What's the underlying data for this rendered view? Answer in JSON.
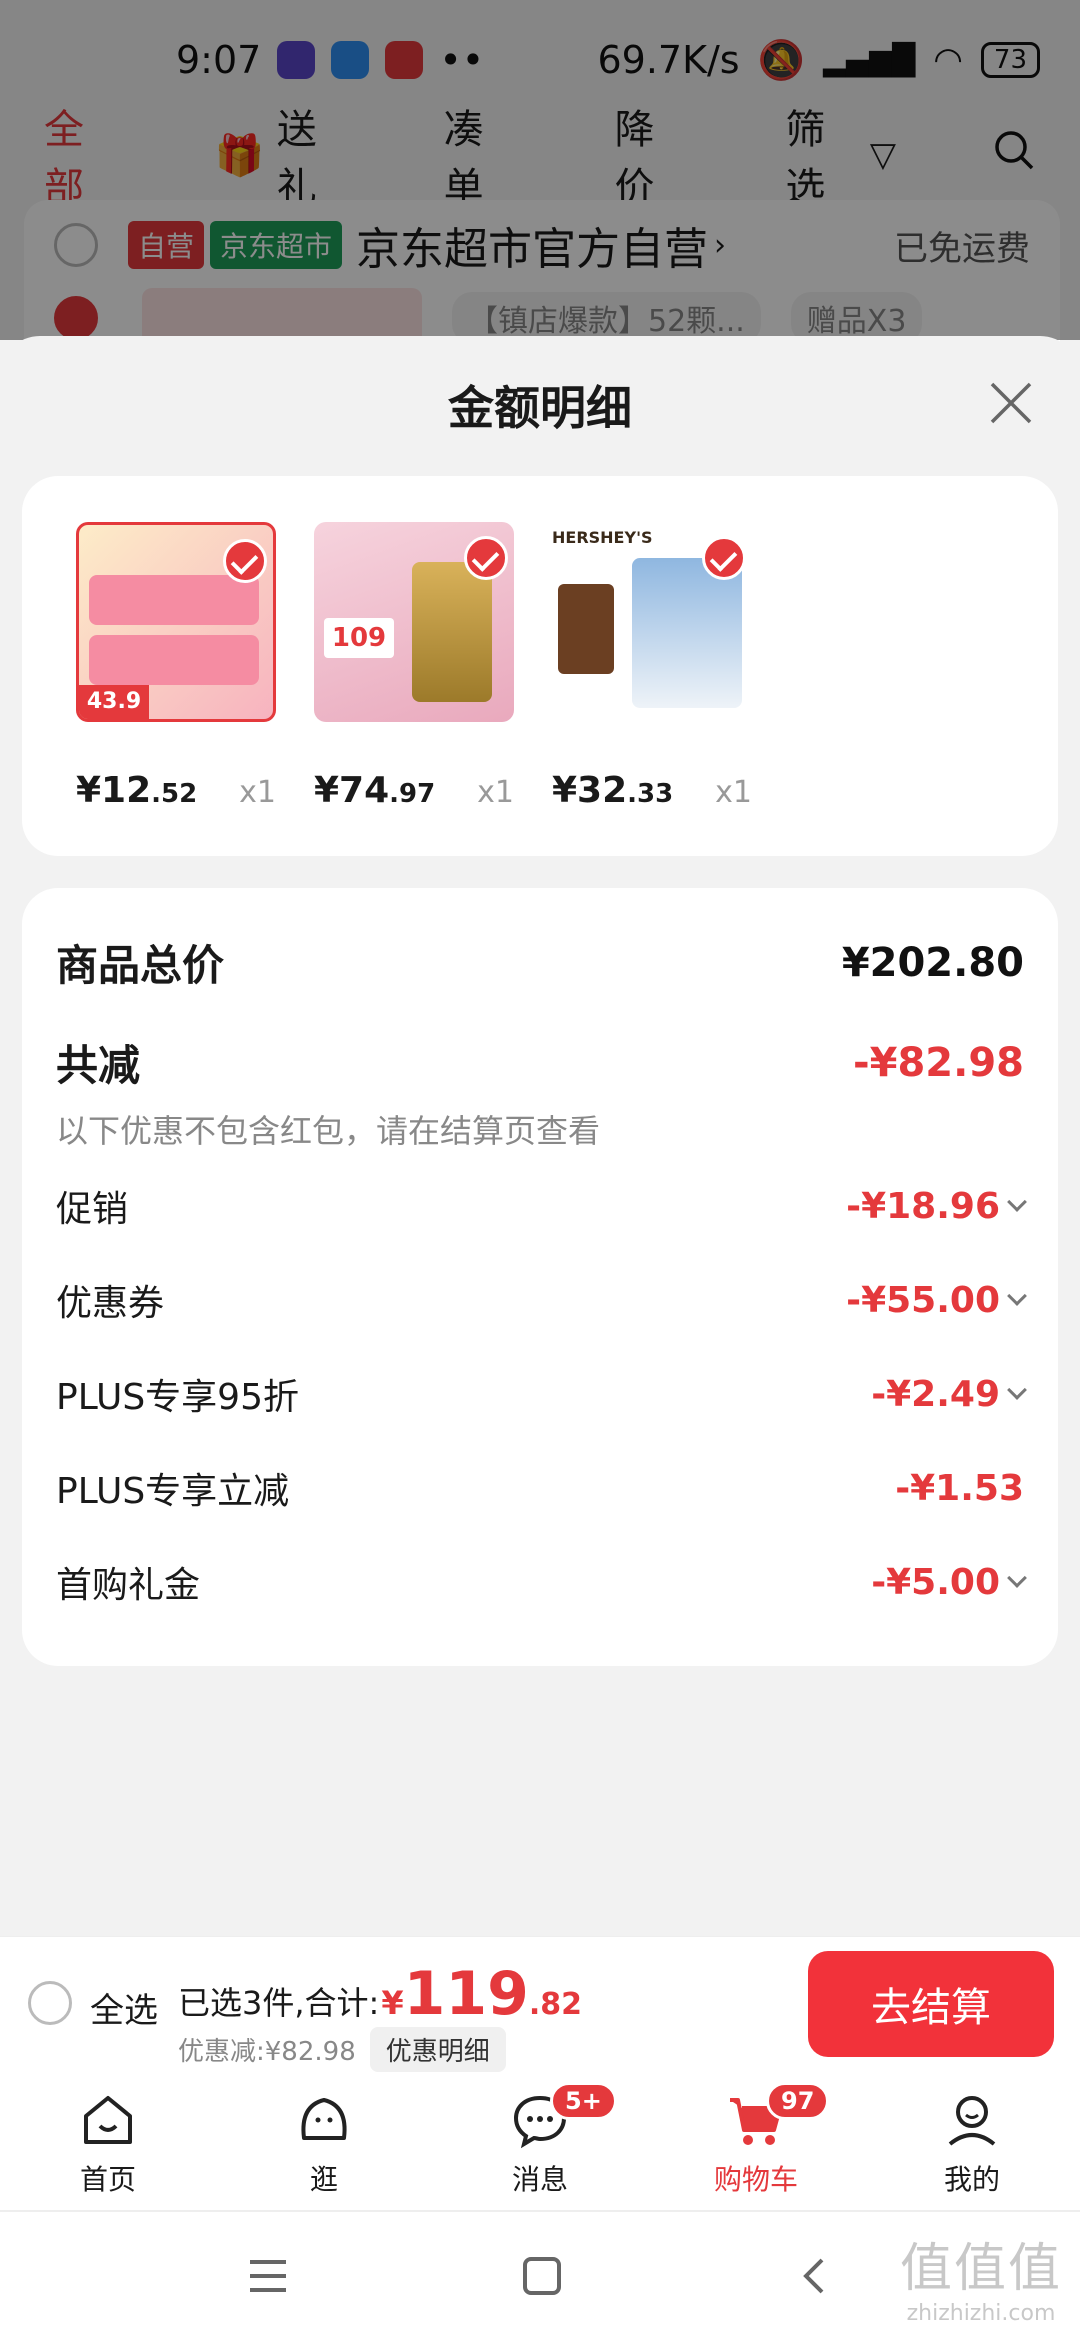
{
  "status_bar": {
    "time": "9:07",
    "network_speed": "69.7K/s",
    "battery": "73",
    "extra": "••"
  },
  "top_tabs": [
    {
      "label": "全部",
      "active": true
    },
    {
      "label": "送礼",
      "icon": "gift-icon"
    },
    {
      "label": "凑单"
    },
    {
      "label": "降价"
    },
    {
      "label": "筛选",
      "icon": "filter-icon"
    }
  ],
  "shop": {
    "tag_self": "自营",
    "tag_market": "京东超市",
    "name": "京东超市官方自营",
    "shipping": "已免运费",
    "product_spec": "【镇店爆款】52颗...",
    "gift_spec": "赠品X3"
  },
  "sheet": {
    "title": "金额明细",
    "items": [
      {
        "price_int": "¥12",
        "price_dec": ".52",
        "qty": "x1",
        "thumb_label": "43.9"
      },
      {
        "price_int": "¥74",
        "price_dec": ".97",
        "qty": "x1",
        "thumb_label": "109"
      },
      {
        "price_int": "¥32",
        "price_dec": ".33",
        "qty": "x1",
        "thumb_label": "HERSHEY'S"
      }
    ],
    "total_label": "商品总价",
    "total_value": "¥202.80",
    "reduce_label": "共减",
    "reduce_value": "-¥82.98",
    "note": "以下优惠不包含红包，请在结算页查看",
    "discounts": [
      {
        "label": "促销",
        "value": "-¥18.96",
        "expand": true
      },
      {
        "label": "优惠券",
        "value": "-¥55.00",
        "expand": true
      },
      {
        "label": "PLUS专享95折",
        "value": "-¥2.49",
        "expand": true
      },
      {
        "label": "PLUS专享立减",
        "value": "-¥1.53",
        "expand": false
      },
      {
        "label": "首购礼金",
        "value": "-¥5.00",
        "expand": true
      }
    ]
  },
  "checkout": {
    "select_all": "全选",
    "summary_prefix": "已选3件,合计:",
    "currency": "¥",
    "total_int": "119",
    "total_dec": ".82",
    "discount_text": "优惠减:¥82.98",
    "discount_detail_btn": "优惠明细",
    "pay_button": "去结算"
  },
  "bottom_nav": [
    {
      "label": "首页",
      "icon": "home-icon"
    },
    {
      "label": "逛",
      "icon": "browse-icon"
    },
    {
      "label": "消息",
      "icon": "message-icon",
      "badge": "5+"
    },
    {
      "label": "购物车",
      "icon": "cart-icon",
      "badge": "97",
      "active": true
    },
    {
      "label": "我的",
      "icon": "profile-icon"
    }
  ],
  "watermark": {
    "big": "值值值",
    "small": "zhizhizhi.com"
  },
  "colors": {
    "accent": "#e4393c",
    "pay_button": "#f2323a",
    "tag_green": "#1e9e5a"
  }
}
